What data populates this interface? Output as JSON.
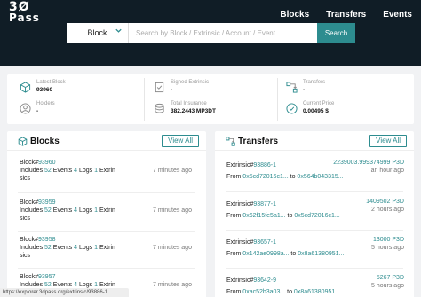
{
  "header": {
    "logo_line1": "3Ø",
    "logo_line2": "Pass",
    "nav": [
      "Blocks",
      "Transfers",
      "Events"
    ]
  },
  "search": {
    "select_value": "Block",
    "placeholder": "Search by Block / Extrinsic / Account / Event",
    "button": "Search"
  },
  "stats": [
    {
      "label": "Latest Block",
      "value": "93960",
      "icon": "cube-icon"
    },
    {
      "label": "Signed Extrinsic",
      "value": "-",
      "icon": "document-check-icon"
    },
    {
      "label": "Transfers",
      "value": "-",
      "icon": "transfer-icon"
    },
    {
      "label": "Holders",
      "value": "-",
      "icon": "user-icon"
    },
    {
      "label": "Total Insurance",
      "value": "382.2443 MP3DT",
      "icon": "coins-icon"
    },
    {
      "label": "Current Price",
      "value": "0.00495 $",
      "icon": "price-icon"
    }
  ],
  "blocks": {
    "title": "Blocks",
    "view_all": "View All",
    "items": [
      {
        "prefix": "Block#",
        "number": "93960",
        "includes": "Includes",
        "events": "52",
        "events_label": "Events",
        "logs": "4",
        "logs_label": "Logs",
        "extrinsics": "1",
        "extrinsics_label_a": "Extrin",
        "extrinsics_label_b": "sics",
        "time": "7 minutes ago"
      },
      {
        "prefix": "Block#",
        "number": "93959",
        "includes": "Includes",
        "events": "52",
        "events_label": "Events",
        "logs": "4",
        "logs_label": "Logs",
        "extrinsics": "1",
        "extrinsics_label_a": "Extrin",
        "extrinsics_label_b": "sics",
        "time": "7 minutes ago"
      },
      {
        "prefix": "Block#",
        "number": "93958",
        "includes": "Includes",
        "events": "52",
        "events_label": "Events",
        "logs": "4",
        "logs_label": "Logs",
        "extrinsics": "1",
        "extrinsics_label_a": "Extrin",
        "extrinsics_label_b": "sics",
        "time": "7 minutes ago"
      },
      {
        "prefix": "Block#",
        "number": "93957",
        "includes": "Includes",
        "events": "52",
        "events_label": "Events",
        "logs": "4",
        "logs_label": "Logs",
        "extrinsics": "1",
        "extrinsics_label_a": "Extrin",
        "extrinsics_label_b": "sics",
        "time": "7 minutes ago"
      }
    ]
  },
  "transfers": {
    "title": "Transfers",
    "view_all": "View All",
    "items": [
      {
        "prefix": "Extrinsic#",
        "id": "93886-1",
        "amount": "2239003.999374999 P3D",
        "from_label": "From",
        "from": "0x5cd72016c1...",
        "to_label": "to",
        "to": "0x564b043315...",
        "time": "an hour ago"
      },
      {
        "prefix": "Extrinsic#",
        "id": "93877-1",
        "amount": "1409502 P3D",
        "from_label": "From",
        "from": "0x62f15fe5a1...",
        "to_label": "to",
        "to": "0x5cd72016c1...",
        "time": "2 hours ago"
      },
      {
        "prefix": "Extrinsic#",
        "id": "93657-1",
        "amount": "13000 P3D",
        "from_label": "From",
        "from": "0x142ae0998a...",
        "to_label": "to",
        "to": "0x8a61380951...",
        "time": "5 hours ago"
      },
      {
        "prefix": "Extrinsic#",
        "id": "93642-9",
        "amount": "5267 P3D",
        "from_label": "From",
        "from": "0xac52b3a03...",
        "to_label": "to",
        "to": "0x8a61380951...",
        "time": "5 hours ago"
      }
    ]
  },
  "status_url": "https://explorer.3dpass.org/extrinsic/93886-1",
  "colors": {
    "accent": "#2d8c8f",
    "header_bg": "#101d26",
    "page_bg": "#f1f2f4"
  }
}
